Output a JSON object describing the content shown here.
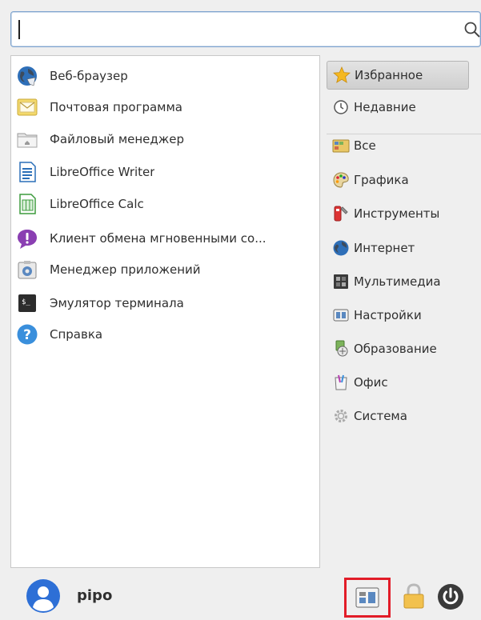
{
  "search": {
    "value": "",
    "placeholder": ""
  },
  "apps": [
    {
      "label": "Веб-браузер",
      "icon": "globe-icon"
    },
    {
      "label": "Почтовая программа",
      "icon": "mail-icon"
    },
    {
      "label": "Файловый менеджер",
      "icon": "folder-icon"
    },
    {
      "label": "LibreOffice Writer",
      "icon": "writer-icon"
    },
    {
      "label": "LibreOffice Calc",
      "icon": "calc-icon"
    },
    {
      "label": "Клиент обмена мгновенными со...",
      "icon": "chat-icon"
    },
    {
      "label": "Менеджер приложений",
      "icon": "package-icon"
    },
    {
      "label": "Эмулятор терминала",
      "icon": "terminal-icon"
    },
    {
      "label": "Справка",
      "icon": "help-icon"
    }
  ],
  "categories": [
    {
      "label": "Избранное",
      "icon": "star-icon",
      "selected": true
    },
    {
      "label": "Недавние",
      "icon": "clock-icon"
    },
    {
      "label": "Все",
      "icon": "all-icon"
    },
    {
      "label": "Графика",
      "icon": "palette-icon"
    },
    {
      "label": "Инструменты",
      "icon": "tools-icon"
    },
    {
      "label": "Интернет",
      "icon": "globe-icon"
    },
    {
      "label": "Мультимедиа",
      "icon": "multimedia-icon"
    },
    {
      "label": "Настройки",
      "icon": "settings-icon"
    },
    {
      "label": "Образование",
      "icon": "education-icon"
    },
    {
      "label": "Офис",
      "icon": "office-icon"
    },
    {
      "label": "Система",
      "icon": "gear-icon"
    }
  ],
  "user": {
    "name": "pipo"
  },
  "bottom_buttons": [
    "settings-manager-icon",
    "lock-icon",
    "power-icon"
  ],
  "colors": {
    "accent": "#3b82d6",
    "highlight_frame": "#e21c28",
    "star": "#f5b820"
  }
}
